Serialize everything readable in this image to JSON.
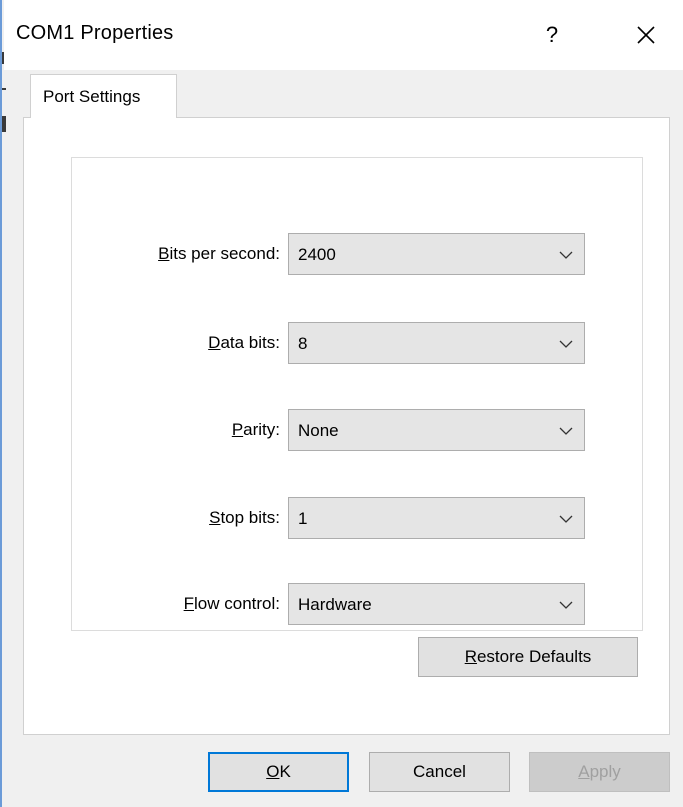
{
  "window": {
    "title": "COM1 Properties",
    "help_glyph": "?"
  },
  "tabs": [
    {
      "label": "Port Settings",
      "selected": true
    }
  ],
  "fields": [
    {
      "label_ul": "B",
      "label_rest": "its per second:",
      "value": "2400"
    },
    {
      "label_ul": "D",
      "label_rest": "ata bits:",
      "value": "8"
    },
    {
      "label_ul": "P",
      "label_rest": "arity:",
      "value": "None"
    },
    {
      "label_ul": "S",
      "label_rest": "top bits:",
      "value": "1"
    },
    {
      "label_ul": "F",
      "label_rest": "low control:",
      "value": "Hardware"
    }
  ],
  "buttons": {
    "restore_ul": "R",
    "restore_rest": "estore Defaults",
    "ok_ul": "O",
    "ok_rest": "K",
    "cancel": "Cancel",
    "apply_ul": "A",
    "apply_rest": "pply"
  },
  "colors": {
    "accent": "#0078d7",
    "window_border": "#6b9bd8",
    "dropdown_bg": "#e5e5e5",
    "button_bg": "#e1e1e1"
  },
  "icons": {
    "close": "close-icon",
    "dropdown": "chevron-down-icon"
  }
}
